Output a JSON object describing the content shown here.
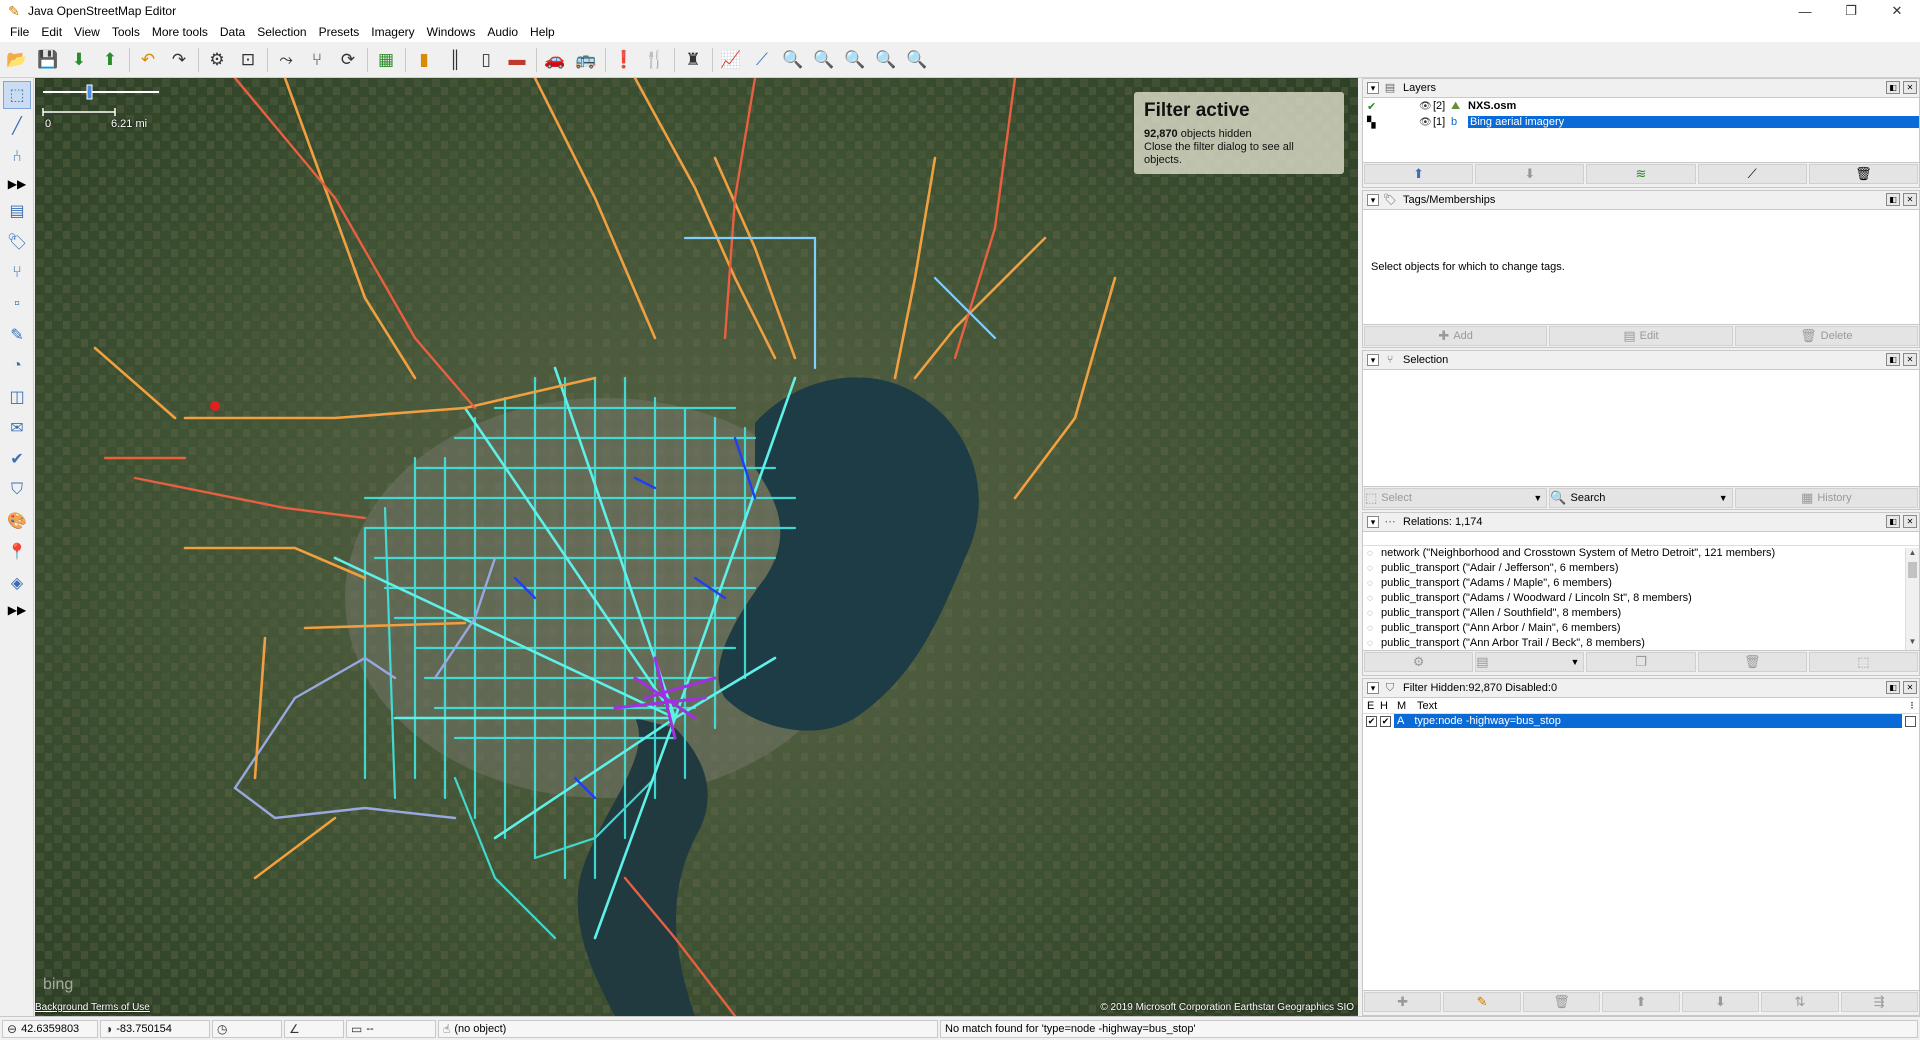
{
  "window": {
    "title": "Java OpenStreetMap Editor",
    "minimize": "—",
    "maximize": "❐",
    "close": "✕"
  },
  "menu": [
    "File",
    "Edit",
    "View",
    "Tools",
    "More tools",
    "Data",
    "Selection",
    "Presets",
    "Imagery",
    "Windows",
    "Audio",
    "Help"
  ],
  "toolbar_icons": [
    "open-file-icon",
    "save-icon",
    "download-icon",
    "upload-icon",
    "undo-icon",
    "redo-icon",
    "preferences-icon",
    "zoom-icon",
    "simplify-icon",
    "merge-icon",
    "refresh-icon",
    "map-icon",
    "traffic-light-icon",
    "lane-icon",
    "bridge-icon",
    "railway-icon",
    "car-icon",
    "bus-icon",
    "warning-icon",
    "restaurant-icon",
    "castle-icon",
    "elevation-icon",
    "measure-icon",
    "zoom-to-layer-icon",
    "zoom-to-selection-icon",
    "zoom-to-conflict-icon",
    "zoom-to-download-icon",
    "zoom-to-problem-icon"
  ],
  "map": {
    "scale_zero": "0",
    "scale_value": "6.21 mi",
    "filter_title": "Filter active",
    "filter_count": "92,870",
    "filter_hidden_text": " objects hidden",
    "filter_hint": "Close the filter dialog to see all objects.",
    "attribution": "© 2019 Microsoft Corporation Earthstar Geographics  SIO",
    "bg_terms": "Background Terms of Use",
    "bing_logo": "bing"
  },
  "layers": {
    "title": "Layers",
    "items": [
      {
        "index": "[2]",
        "name": "NXS.osm",
        "active": true
      },
      {
        "index": "[1]",
        "name": "Bing aerial imagery",
        "selected": true
      }
    ]
  },
  "tags": {
    "title": "Tags/Memberships",
    "message": "Select objects for which to change tags.",
    "add": "Add",
    "edit": "Edit",
    "delete": "Delete"
  },
  "selection": {
    "title": "Selection",
    "select": "Select",
    "search": "Search",
    "history": "History"
  },
  "relations": {
    "title": "Relations: 1,174",
    "items": [
      "network (\"Neighborhood and Crosstown System of Metro Detroit\", 121 members)",
      "public_transport (\"Adair / Jefferson\", 6 members)",
      "public_transport (\"Adams / Maple\", 6 members)",
      "public_transport (\"Adams / Woodward / Lincoln St\", 8 members)",
      "public_transport (\"Allen / Southfield\", 8 members)",
      "public_transport (\"Ann Arbor / Main\", 6 members)",
      "public_transport (\"Ann Arbor Trail / Beck\", 8 members)"
    ]
  },
  "filter": {
    "title": "Filter Hidden:92,870 Disabled:0",
    "col_e": "E",
    "col_h": "H",
    "col_m": "M",
    "col_text": "Text",
    "row_mode": "A",
    "row_text": "type:node -highway=bus_stop"
  },
  "status": {
    "lat": "42.6359803",
    "lon": "-83.750154",
    "heading": "",
    "angle": "",
    "distance": "--",
    "object": "(no object)",
    "message": "No match found for 'type=node -highway=bus_stop'"
  },
  "colors": {
    "selection_blue": "#0a6ad6",
    "route_cyan": "#3fe8e0",
    "route_orange": "#f0a040",
    "route_purple": "#a030e0",
    "lake_blue": "#1e3c45"
  }
}
